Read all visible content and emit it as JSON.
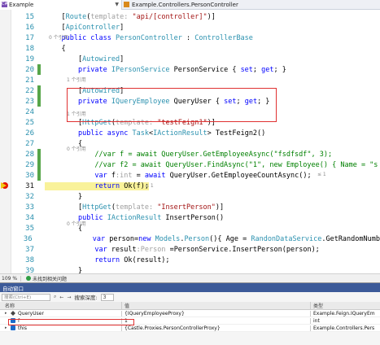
{
  "top_tabs": {
    "project_label": "Example",
    "class_label": "Example.Controllers.PersonController"
  },
  "code_lines": [
    {
      "n": "15",
      "saved": false,
      "parts": [
        [
          "",
          "    ["
        ],
        [
          "ty",
          "Route"
        ],
        [
          "",
          "("
        ],
        [
          "lbl",
          "template: "
        ],
        [
          "str",
          "\"api/[controller]\""
        ],
        [
          "",
          ")]"
        ]
      ]
    },
    {
      "n": "16",
      "saved": false,
      "parts": [
        [
          "",
          "    ["
        ],
        [
          "ty",
          "ApiController"
        ],
        [
          "",
          "]"
        ]
      ]
    },
    {
      "n": "17",
      "saved": false,
      "parts": [
        [
          "",
          "    "
        ],
        [
          "kw",
          "public class "
        ],
        [
          "ty",
          "PersonController"
        ],
        [
          "",
          " : "
        ],
        [
          "ty",
          "ControllerBase"
        ]
      ]
    },
    {
      "n": "18",
      "saved": false,
      "parts": [
        [
          "",
          "    {"
        ]
      ]
    },
    {
      "n": "19",
      "saved": false,
      "parts": [
        [
          "",
          "        ["
        ],
        [
          "ty",
          "Autowired"
        ],
        [
          "",
          "]"
        ]
      ]
    },
    {
      "n": "20",
      "saved": true,
      "parts": [
        [
          "",
          "        "
        ],
        [
          "kw",
          "private "
        ],
        [
          "ty",
          "IPersonService"
        ],
        [
          "",
          " PersonService { "
        ],
        [
          "kw",
          "set"
        ],
        [
          "",
          "; "
        ],
        [
          "kw",
          "get"
        ],
        [
          "",
          "; }"
        ]
      ]
    },
    {
      "n": "21",
      "saved": false,
      "parts": [
        [
          "",
          ""
        ]
      ]
    },
    {
      "n": "22",
      "saved": true,
      "parts": [
        [
          "",
          "        ["
        ],
        [
          "ty",
          "Autowired"
        ],
        [
          "",
          "]"
        ]
      ]
    },
    {
      "n": "23",
      "saved": true,
      "parts": [
        [
          "",
          "        "
        ],
        [
          "kw",
          "private "
        ],
        [
          "ty",
          "IQueryEmployee"
        ],
        [
          "",
          " QueryUser { "
        ],
        [
          "kw",
          "set"
        ],
        [
          "",
          "; "
        ],
        [
          "kw",
          "get"
        ],
        [
          "",
          "; }"
        ]
      ]
    },
    {
      "n": "24",
      "saved": false,
      "parts": [
        [
          "",
          ""
        ]
      ]
    },
    {
      "n": "25",
      "saved": false,
      "parts": [
        [
          "",
          "        ["
        ],
        [
          "ty",
          "HttpGet"
        ],
        [
          "",
          "("
        ],
        [
          "lbl",
          "template: "
        ],
        [
          "str",
          "\"testFeign1\""
        ],
        [
          "",
          ")]"
        ]
      ]
    },
    {
      "n": "26",
      "saved": false,
      "parts": [
        [
          "",
          "        "
        ],
        [
          "kw",
          "public async "
        ],
        [
          "ty",
          "Task"
        ],
        [
          "",
          "<"
        ],
        [
          "ty",
          "IActionResult"
        ],
        [
          "",
          "> "
        ],
        [
          "",
          "TestFeign2()"
        ]
      ]
    },
    {
      "n": "27",
      "saved": false,
      "parts": [
        [
          "",
          "        {"
        ]
      ]
    },
    {
      "n": "28",
      "saved": true,
      "parts": [
        [
          "",
          "            "
        ],
        [
          "cm",
          "//var f = await QueryUser.GetEmployeeAsync(\"fsdfsdf\", 3);"
        ]
      ]
    },
    {
      "n": "29",
      "saved": true,
      "parts": [
        [
          "",
          "            "
        ],
        [
          "cm",
          "//var f2 = await QueryUser.FindAsync(\"1\", new Employee() { Name = \"s"
        ]
      ]
    },
    {
      "n": "30",
      "saved": true,
      "parts": [
        [
          "",
          "            "
        ],
        [
          "kw",
          "var "
        ],
        [
          "",
          "f"
        ],
        [
          "lbl",
          ":int"
        ],
        [
          "",
          " = "
        ],
        [
          "kw",
          "await "
        ],
        [
          "",
          "QueryUser.GetEmployeeCountAsync();"
        ]
      ]
    },
    {
      "n": "31",
      "saved": false,
      "parts": [
        [
          "",
          "            "
        ],
        [
          "kw",
          "return "
        ],
        [
          "",
          "Ok(f);"
        ]
      ]
    },
    {
      "n": "32",
      "saved": false,
      "parts": [
        [
          "",
          "        }"
        ]
      ]
    },
    {
      "n": "33",
      "saved": false,
      "parts": [
        [
          "",
          "        ["
        ],
        [
          "ty",
          "HttpGet"
        ],
        [
          "",
          "("
        ],
        [
          "lbl",
          "template: "
        ],
        [
          "str",
          "\"InsertPerson\""
        ],
        [
          "",
          ")]"
        ]
      ]
    },
    {
      "n": "34",
      "saved": false,
      "parts": [
        [
          "",
          "        "
        ],
        [
          "kw",
          "public "
        ],
        [
          "ty",
          "IActionResult"
        ],
        [
          "",
          " InsertPerson()"
        ]
      ]
    },
    {
      "n": "35",
      "saved": false,
      "parts": [
        [
          "",
          "        {"
        ]
      ]
    },
    {
      "n": "36",
      "saved": false,
      "parts": [
        [
          "",
          "            "
        ],
        [
          "kw",
          "var "
        ],
        [
          "",
          "person="
        ],
        [
          "kw",
          "new "
        ],
        [
          "ty",
          "Models"
        ],
        [
          "",
          "."
        ],
        [
          "ty",
          "Person"
        ],
        [
          "",
          "(){ Age = "
        ],
        [
          "ty",
          "RandonDataService"
        ],
        [
          "",
          ".GetRandomNumb"
        ]
      ]
    },
    {
      "n": "37",
      "saved": false,
      "parts": [
        [
          "",
          "            "
        ],
        [
          "kw",
          "var "
        ],
        [
          "",
          "result"
        ],
        [
          "lbl",
          ":Person"
        ],
        [
          "",
          " =PersonService.InsertPerson(person);"
        ]
      ]
    },
    {
      "n": "38",
      "saved": false,
      "parts": [
        [
          "",
          "            "
        ],
        [
          "kw",
          "return "
        ],
        [
          "",
          "Ok(result);"
        ]
      ]
    },
    {
      "n": "39",
      "saved": false,
      "parts": [
        [
          "",
          "        }"
        ]
      ]
    }
  ],
  "hints": {
    "refs_0": "0 个引用",
    "refs_1": "1 个引用",
    "time_30": "≤ 1",
    "time_31": "≤ 1"
  },
  "editor_status": {
    "zoom": "109 %",
    "issues": "未找到相关问题"
  },
  "autos": {
    "title": "自动窗口",
    "search_placeholder": "搜索(Ctrl+E)",
    "search_depth_label": "搜索深度:",
    "search_depth_value": "3",
    "col_name": "名称",
    "col_value": "值",
    "col_type": "类型",
    "rows": [
      {
        "name": "QueryUser",
        "value": "{IQueryEmployeeProxy}",
        "type": "Example.Feign.IQueryEm"
      },
      {
        "name": "f",
        "value": "1",
        "type": "int"
      },
      {
        "name": "this",
        "value": "{Castle.Proxies.PersonControllerProxy}",
        "type": "Example.Controllers.Pers"
      }
    ]
  },
  "colors": {
    "keyword": "#0000ff",
    "type": "#2b91af",
    "string": "#a31515",
    "comment": "#008000",
    "breakpoint": "#e51400",
    "highlight_box": "#e03131"
  }
}
